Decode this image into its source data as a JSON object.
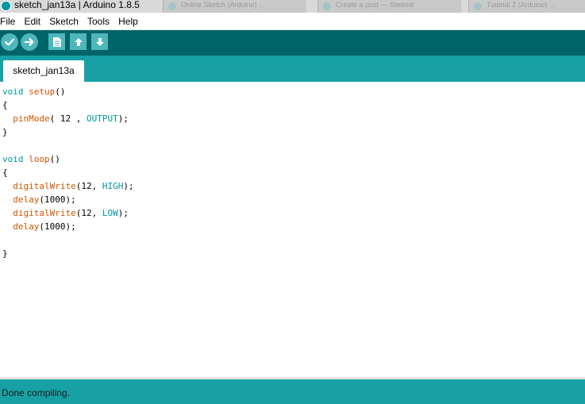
{
  "window": {
    "title": "sketch_jan13a | Arduino 1.8.5",
    "background_tabs": [
      "Online Sketch (Arduino) ...",
      "Create a post — Steemit",
      "Tutorial 2 (Arduino) ..."
    ]
  },
  "menu": [
    "File",
    "Edit",
    "Sketch",
    "Tools",
    "Help"
  ],
  "toolbar": {
    "buttons": [
      "verify",
      "upload",
      "new",
      "open",
      "save"
    ],
    "icons": [
      "checkmark-icon",
      "arrow-right-icon",
      "document-icon",
      "arrow-up-icon",
      "arrow-down-icon"
    ]
  },
  "editor": {
    "tab_label": "sketch_jan13a",
    "code_lines": [
      "void setup()",
      "{",
      "  pinMode( 12 , OUTPUT);",
      "}",
      "",
      "void loop()",
      "{",
      "  digitalWrite(12, HIGH);",
      "  delay(1000);",
      "  digitalWrite(12, LOW);",
      "  delay(1000);",
      "",
      "}"
    ]
  },
  "status": {
    "message": "Done compiling."
  },
  "colors": {
    "toolbar_bg": "#006468",
    "tabbar_bg": "#17a1a5",
    "button_bg": "#4db7bb",
    "keyword_teal": "#00979c",
    "function_orange": "#d35400"
  }
}
